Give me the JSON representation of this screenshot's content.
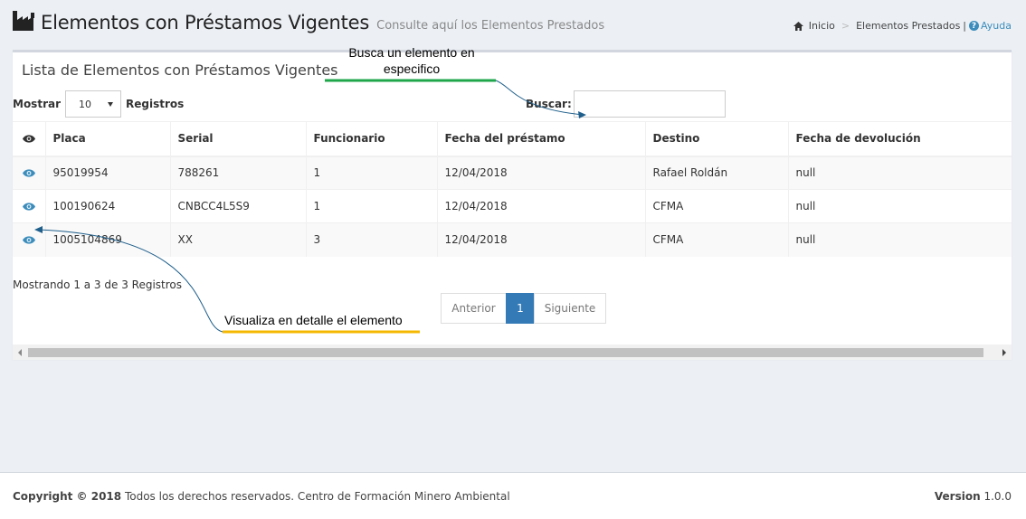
{
  "header": {
    "title": "Elementos con Préstamos Vigentes",
    "subtitle": "Consulte aquí los Elementos Prestados",
    "factory_icon": "industry-icon"
  },
  "breadcrumb": {
    "home": "Inicio",
    "current": "Elementos Prestados",
    "separator_bar": "|",
    "help": "Ayuda",
    "help_glyph": "?"
  },
  "box": {
    "title": "Lista de Elementos con Préstamos Vigentes"
  },
  "length": {
    "prefix": "Mostrar",
    "value": "10",
    "suffix": "Registros"
  },
  "search": {
    "label": "Buscar:",
    "value": ""
  },
  "table": {
    "columns": [
      "Placa",
      "Serial",
      "Funcionario",
      "Fecha del préstamo",
      "Destino",
      "Fecha de devolución"
    ],
    "rows": [
      [
        "95019954",
        "788261",
        "1",
        "12/04/2018",
        "Rafael Roldán",
        "null"
      ],
      [
        "100190624",
        "CNBCC4L5S9",
        "1",
        "12/04/2018",
        "CFMA",
        "null"
      ],
      [
        "1005104869",
        "XX",
        "3",
        "12/04/2018",
        "CFMA",
        "null"
      ]
    ]
  },
  "info": "Mostrando 1 a 3 de 3 Registros",
  "pagination": {
    "prev": "Anterior",
    "current": "1",
    "next": "Siguiente"
  },
  "footer": {
    "copyright_bold": "Copyright © 2018",
    "copyright_text": "Todos los derechos reservados. Centro de Formación Minero Ambiental",
    "version_bold": "Version",
    "version_number": "1.0.0"
  },
  "annotations": {
    "search_note": "Busca un elemento en especifico",
    "detail_note": "Visualiza en detalle el elemento",
    "search_color": "#1fa64a",
    "detail_color": "#f5b800",
    "arrow_color": "#1f5f8b"
  },
  "colors": {
    "primary": "#337ab7",
    "link": "#3c8dbc",
    "background": "#ecf0f5"
  }
}
